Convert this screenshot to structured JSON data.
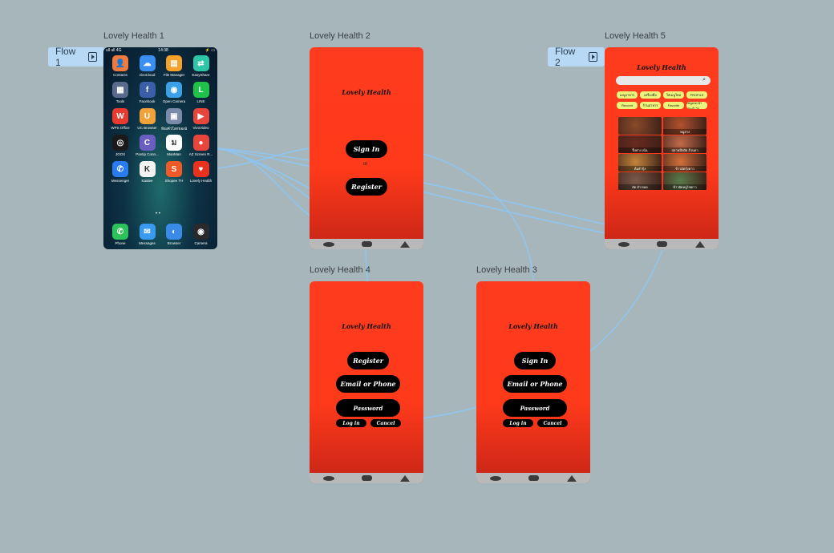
{
  "frames": {
    "f1": {
      "label": "Lovely Health 1"
    },
    "f2": {
      "label": "Lovely Health 2"
    },
    "f3": {
      "label": "Lovely Health 3"
    },
    "f4": {
      "label": "Lovely Health 4"
    },
    "f5": {
      "label": "Lovely Health 5"
    }
  },
  "flows": [
    {
      "label": "Flow 1"
    },
    {
      "label": "Flow 2"
    }
  ],
  "home_screen": {
    "status_left": "ull ull 4G",
    "time": "14:38",
    "status_right": "⚡ ▭",
    "apps": [
      {
        "label": "Contacts",
        "color": "#f07a3c",
        "glyph": "👤"
      },
      {
        "label": "vivoCloud",
        "color": "#3a8ff0",
        "glyph": "☁"
      },
      {
        "label": "File Manager",
        "color": "#f5a22b",
        "glyph": "▤"
      },
      {
        "label": "EasyShare",
        "color": "#2dc6a8",
        "glyph": "⇄"
      },
      {
        "label": "Tools",
        "color": "#5a6a8a",
        "glyph": "▦"
      },
      {
        "label": "Facebook",
        "color": "#3b5ea8",
        "glyph": "f"
      },
      {
        "label": "Open Camera",
        "color": "#3aa0e8",
        "glyph": "◉"
      },
      {
        "label": "LINE",
        "color": "#20c14a",
        "glyph": "L"
      },
      {
        "label": "WPS Office",
        "color": "#e83a2f",
        "glyph": "W"
      },
      {
        "label": "UC Browser",
        "color": "#f2a23a",
        "glyph": "U"
      },
      {
        "label": "ห้องค้วโลกของฉัน",
        "color": "#7a8aa8",
        "glyph": "▣"
      },
      {
        "label": "VivoVideo",
        "color": "#e8463c",
        "glyph": "▶"
      },
      {
        "label": "JOOX",
        "color": "#1a1a1a",
        "glyph": "◎"
      },
      {
        "label": "Pantip Conn...",
        "color": "#6a5ec0",
        "glyph": "C"
      },
      {
        "label": "ManMan",
        "color": "#ffffff",
        "glyph": "ม"
      },
      {
        "label": "AZ Screen R...",
        "color": "#e8463c",
        "glyph": "●"
      },
      {
        "label": "Messenger",
        "color": "#2a7af0",
        "glyph": "✆"
      },
      {
        "label": "Kaidee",
        "color": "#f2f2f2",
        "glyph": "K"
      },
      {
        "label": "Shopee TH",
        "color": "#f05a28",
        "glyph": "S"
      },
      {
        "label": "Lovely Health",
        "color": "#e8321e",
        "glyph": "♥"
      }
    ],
    "dock": [
      {
        "label": "Phone",
        "color": "#2ec25a",
        "glyph": "✆"
      },
      {
        "label": "Messages",
        "color": "#3a9af0",
        "glyph": "✉"
      },
      {
        "label": "Browser",
        "color": "#3a8ae8",
        "glyph": "◐"
      },
      {
        "label": "Camera",
        "color": "#2a2a2a",
        "glyph": "◉"
      }
    ]
  },
  "app_name": "Lovely Health",
  "screen2": {
    "sign_in": "Sign In",
    "register": "Register",
    "or": "or"
  },
  "screen3": {
    "sign_in": "Sign In",
    "email": "Email or Phone",
    "password": "Password",
    "login": "Log in",
    "cancel": "Cancel"
  },
  "screen4": {
    "register": "Register",
    "email": "Email or Phone",
    "password": "Password",
    "login": "Log in",
    "cancel": "Cancel"
  },
  "screen5": {
    "chips": [
      "เมนูอาหาร",
      "เครื่องดื่ม",
      "ใส่เมนูใหม่",
      "PROFILE",
      "Recomt",
      "ร้านอาหาร",
      "Favorite",
      "เมนูแนะนำประจำวัน"
    ],
    "foods": [
      {
        "caption": "",
        "color": "#8a4a2a"
      },
      {
        "caption": "หมูย่าง",
        "color": "#b3522e"
      },
      {
        "caption": "ปิ้งย่าง เน้น",
        "color": "#6a2a20"
      },
      {
        "caption": "ปลาหมึกผัด ล้วนดา",
        "color": "#c26a4a"
      },
      {
        "caption": "ต้มยำกุ้ง",
        "color": "#c2843a"
      },
      {
        "caption": "ข้าวผัดกุ้งดาว",
        "color": "#d0703a"
      },
      {
        "caption": "ผัด ยำ ทอด",
        "color": "#7a5a4a"
      },
      {
        "caption": "ข้าวผัดหมูไข่ดาว",
        "color": "#5a7a4a"
      }
    ]
  }
}
